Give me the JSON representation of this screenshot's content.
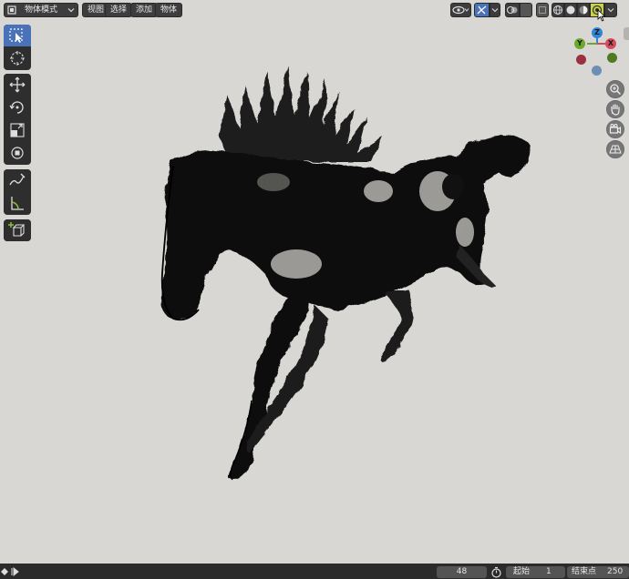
{
  "header": {
    "mode_label": "物体模式",
    "menus": {
      "view": "视图",
      "select": "选择",
      "add": "添加",
      "object": "物体"
    }
  },
  "viewport": {
    "background_color": "#d9d7d3",
    "gizmo": {
      "z_label": "Z",
      "y_label": "Y",
      "x_label": "X",
      "z_color": "#2f86d8",
      "y_color": "#6ca82b",
      "x_color": "#d44c5c"
    }
  },
  "toolbar": {
    "active_tool": "select-box",
    "active_color": "#4a72b8"
  },
  "timeline": {
    "current_frame": "48",
    "start_label": "起始",
    "start_value": "1",
    "end_label": "结束点",
    "end_value": "250"
  }
}
